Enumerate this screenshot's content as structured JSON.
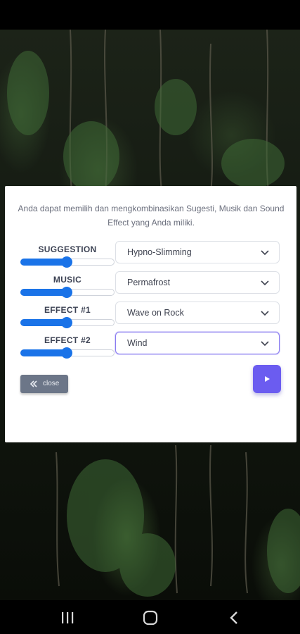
{
  "modal": {
    "intro_text": "Anda dapat memilih dan mengkombinasikan Sugesti, Musik dan Sound Effect yang Anda miliki.",
    "rows": [
      {
        "label": "SUGGESTION",
        "selected": "Hypno-Slimming",
        "volume": 0.5
      },
      {
        "label": "MUSIC",
        "selected": "Permafrost",
        "volume": 0.5
      },
      {
        "label": "EFFECT #1",
        "selected": "Wave on Rock",
        "volume": 0.5
      },
      {
        "label": "EFFECT #2",
        "selected": "Wind",
        "volume": 0.5
      }
    ],
    "close_label": "close",
    "accent_color": "#6b5cf0",
    "slider_color": "#1a73e8"
  },
  "icons": {
    "close": "double-chevron-left-icon",
    "play": "play-icon",
    "select": "chevron-down-icon",
    "nav": [
      "recent-apps-icon",
      "home-icon",
      "back-icon"
    ]
  }
}
